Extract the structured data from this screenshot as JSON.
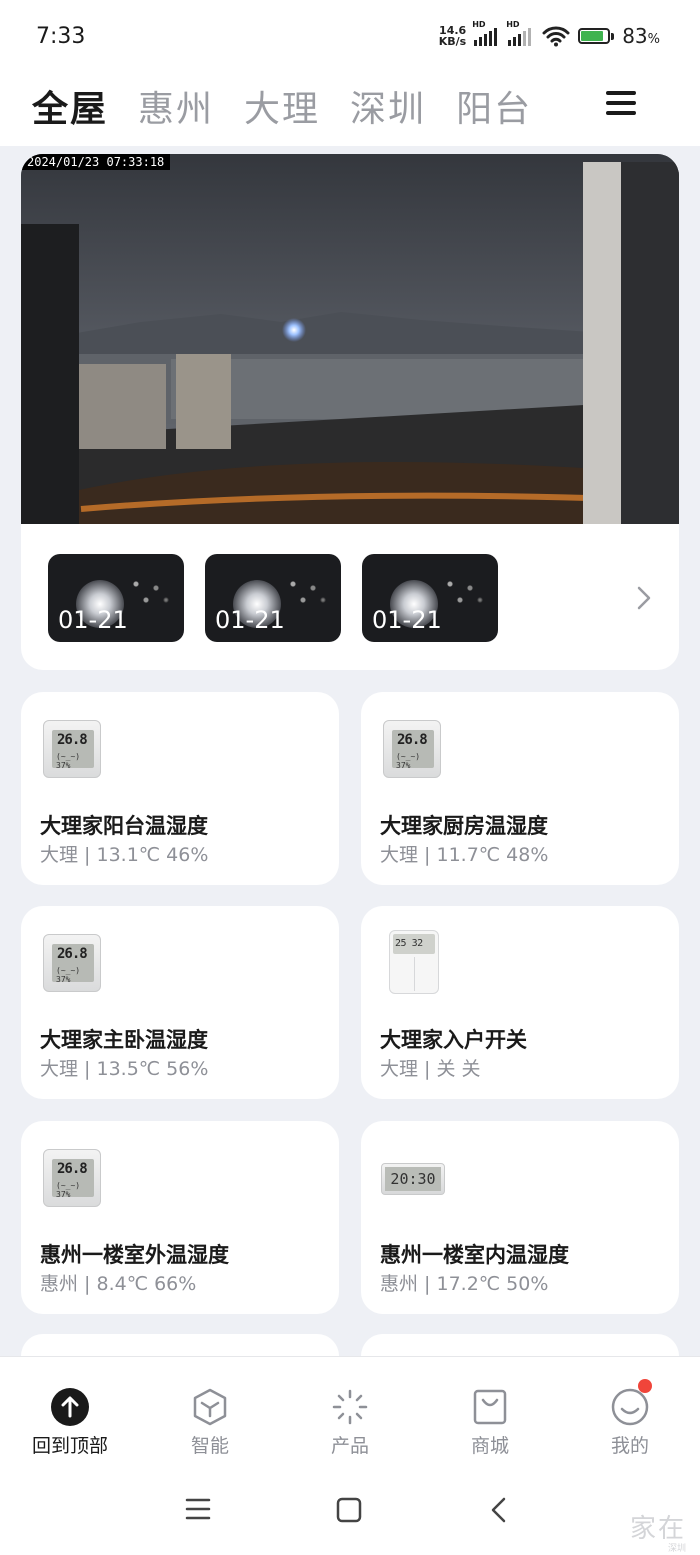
{
  "status_bar": {
    "time": "7:33",
    "net_speed_value": "14.6",
    "net_speed_unit": "KB/s",
    "hd_label": "HD",
    "battery_percent": "83",
    "battery_percent_sign": "%",
    "battery_level": 0.83,
    "battery_color": "#3fb34f"
  },
  "header": {
    "tabs": [
      {
        "label": "全屋",
        "active": true
      },
      {
        "label": "惠州",
        "active": false
      },
      {
        "label": "大理",
        "active": false
      },
      {
        "label": "深圳",
        "active": false
      },
      {
        "label": "阳台",
        "active": false
      }
    ]
  },
  "camera": {
    "timestamp": "2024/01/23  07:33:18",
    "thumbnails": [
      {
        "date": "01-21"
      },
      {
        "date": "01-21"
      },
      {
        "date": "01-21"
      }
    ]
  },
  "devices": [
    {
      "name": "大理家阳台温湿度",
      "status": "大理 | 13.1℃ 46%",
      "icon": "thermo-hygrometer-icon"
    },
    {
      "name": "大理家厨房温湿度",
      "status": "大理 | 11.7℃ 48%",
      "icon": "thermo-hygrometer-icon"
    },
    {
      "name": "大理家主卧温湿度",
      "status": "大理 | 13.5℃ 56%",
      "icon": "thermo-hygrometer-icon"
    },
    {
      "name": "大理家入户开关",
      "status": "大理 | 关 关",
      "icon": "wall-switch-icon"
    },
    {
      "name": "惠州一楼室外温湿度",
      "status": "惠州 | 8.4℃ 66%",
      "icon": "thermo-hygrometer-icon"
    },
    {
      "name": "惠州一楼室内温湿度",
      "status": "惠州 | 17.2℃ 50%",
      "icon": "clock-hygrometer-icon"
    }
  ],
  "icon_screens": {
    "sensor_big": "26.8",
    "sensor_small": "(~_~) 37%",
    "switch_left": "25",
    "switch_right": "32",
    "clock": "20:30"
  },
  "bottom_nav": [
    {
      "label": "回到顶部",
      "icon": "back-to-top-icon",
      "active": true
    },
    {
      "label": "智能",
      "icon": "smart-cube-icon",
      "active": false
    },
    {
      "label": "产品",
      "icon": "product-sparkle-icon",
      "active": false
    },
    {
      "label": "商城",
      "icon": "shop-bag-icon",
      "active": false
    },
    {
      "label": "我的",
      "icon": "profile-face-icon",
      "active": false,
      "badge": true
    }
  ],
  "watermark": {
    "text": "家在",
    "sub": "深圳"
  },
  "colors": {
    "accent_red": "#f0453a",
    "text_primary": "#1a1a1a",
    "text_secondary": "#8e9097",
    "background": "#eef0f5"
  }
}
